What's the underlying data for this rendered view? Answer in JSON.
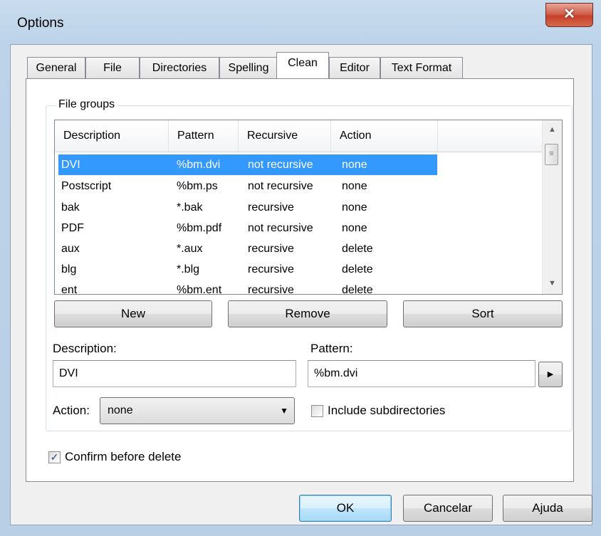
{
  "window": {
    "title": "Options",
    "close_glyph": "✕"
  },
  "tabs": [
    {
      "label": "General"
    },
    {
      "label": "File"
    },
    {
      "label": "Directories"
    },
    {
      "label": "Spelling"
    },
    {
      "label": "Clean",
      "active": true
    },
    {
      "label": "Editor"
    },
    {
      "label": "Text Format"
    }
  ],
  "file_groups": {
    "label": "File groups",
    "columns": [
      "Description",
      "Pattern",
      "Recursive",
      "Action"
    ],
    "rows": [
      {
        "description": "DVI",
        "pattern": "%bm.dvi",
        "recursive": "not recursive",
        "action": "none",
        "selected": true
      },
      {
        "description": "Postscript",
        "pattern": "%bm.ps",
        "recursive": "not recursive",
        "action": "none"
      },
      {
        "description": "bak",
        "pattern": "*.bak",
        "recursive": "recursive",
        "action": "none"
      },
      {
        "description": "PDF",
        "pattern": "%bm.pdf",
        "recursive": "not recursive",
        "action": "none"
      },
      {
        "description": "aux",
        "pattern": "*.aux",
        "recursive": "recursive",
        "action": "delete"
      },
      {
        "description": "blg",
        "pattern": "*.blg",
        "recursive": "recursive",
        "action": "delete"
      },
      {
        "description": "ent",
        "pattern": "%bm.ent",
        "recursive": "recursive",
        "action": "delete"
      }
    ],
    "buttons": {
      "new": "New",
      "remove": "Remove",
      "sort": "Sort"
    },
    "description_label": "Description:",
    "description_value": "DVI",
    "pattern_label": "Pattern:",
    "pattern_value": "%bm.dvi",
    "action_label": "Action:",
    "action_value": "none",
    "include_subdirectories_label": "Include subdirectories",
    "include_subdirectories_checked": false
  },
  "confirm_before_delete": {
    "label": "Confirm before delete",
    "checked": true
  },
  "dialog_buttons": {
    "ok": "OK",
    "cancel": "Cancelar",
    "help": "Ajuda"
  },
  "glyphs": {
    "check": "✓",
    "dropdown": "▼",
    "arrow_right": "▶",
    "scroll_up": "▲",
    "scroll_down": "▼",
    "grip": "≡"
  }
}
